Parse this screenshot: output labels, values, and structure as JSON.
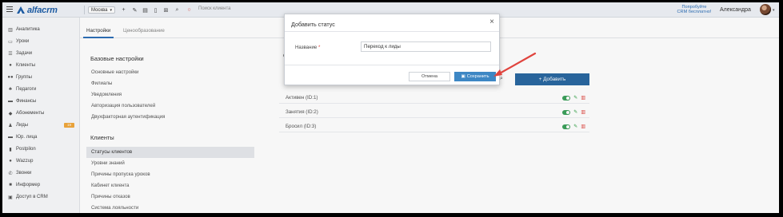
{
  "topbar": {
    "brand": "alfacrm",
    "city": "Москва",
    "search_placeholder": "Поиск клиента",
    "promo_line1": "Попробуйте",
    "promo_line2": "CRM бесплатно!",
    "user_name": "Александра",
    "brand_color": "#1f5fa8"
  },
  "sidebar": {
    "items": [
      {
        "label": "Аналитика",
        "icon": "chart-icon"
      },
      {
        "label": "Уроки",
        "icon": "calendar-icon"
      },
      {
        "label": "Задачи",
        "icon": "tasks-icon"
      },
      {
        "label": "Клиенты",
        "icon": "user-icon"
      },
      {
        "label": "Группы",
        "icon": "users-icon"
      },
      {
        "label": "Педагоги",
        "icon": "teacher-icon"
      },
      {
        "label": "Финансы",
        "icon": "money-icon"
      },
      {
        "label": "Абонементы",
        "icon": "tag-icon"
      },
      {
        "label": "Лиды",
        "icon": "leads-icon",
        "badge": "19"
      },
      {
        "label": "Юр. лица",
        "icon": "building-icon"
      },
      {
        "label": "Postpilon",
        "icon": "postpilon-icon"
      },
      {
        "label": "Wazzup",
        "icon": "chat-icon"
      },
      {
        "label": "Звонки",
        "icon": "phone-icon"
      },
      {
        "label": "Информер",
        "icon": "informer-icon"
      },
      {
        "label": "Доступ в CRM",
        "icon": "lock-icon"
      }
    ]
  },
  "tabs": [
    {
      "label": "Настройки",
      "active": true
    },
    {
      "label": "Ценообразование",
      "active": false
    }
  ],
  "settings_nav": {
    "section1_title": "Базовые настройки",
    "section1_items": [
      "Основные настройки",
      "Филиалы",
      "Уведомления",
      "Авторизация пользователей",
      "Двухфакторная аутентификация"
    ],
    "section2_title": "Клиенты",
    "section2_items": [
      "Статусы клиентов",
      "Уровни знаний",
      "Причины пропуска уроков",
      "Кабинет клиента",
      "Причины отказов",
      "Система лояльности"
    ],
    "active_item": "Статусы клиентов"
  },
  "content": {
    "section_title_partial": "С",
    "add_button_label": "+ Добавить",
    "statuses": [
      {
        "name": "Активен (ID:1)"
      },
      {
        "name": "Занятия (ID:2)"
      },
      {
        "name": "Бросил (ID:3)"
      }
    ]
  },
  "modal": {
    "title": "Добавить статус",
    "field_label": "Название",
    "required_mark": "*",
    "field_value": "Переход к лиды",
    "cancel_label": "Отмена",
    "save_label": "Сохранить"
  },
  "colors": {
    "accent": "#2a68a0",
    "save_button": "#3d87c4",
    "toggle_on": "#3ca05b",
    "arrow": "#e0443e",
    "badge": "#f0a83c"
  }
}
